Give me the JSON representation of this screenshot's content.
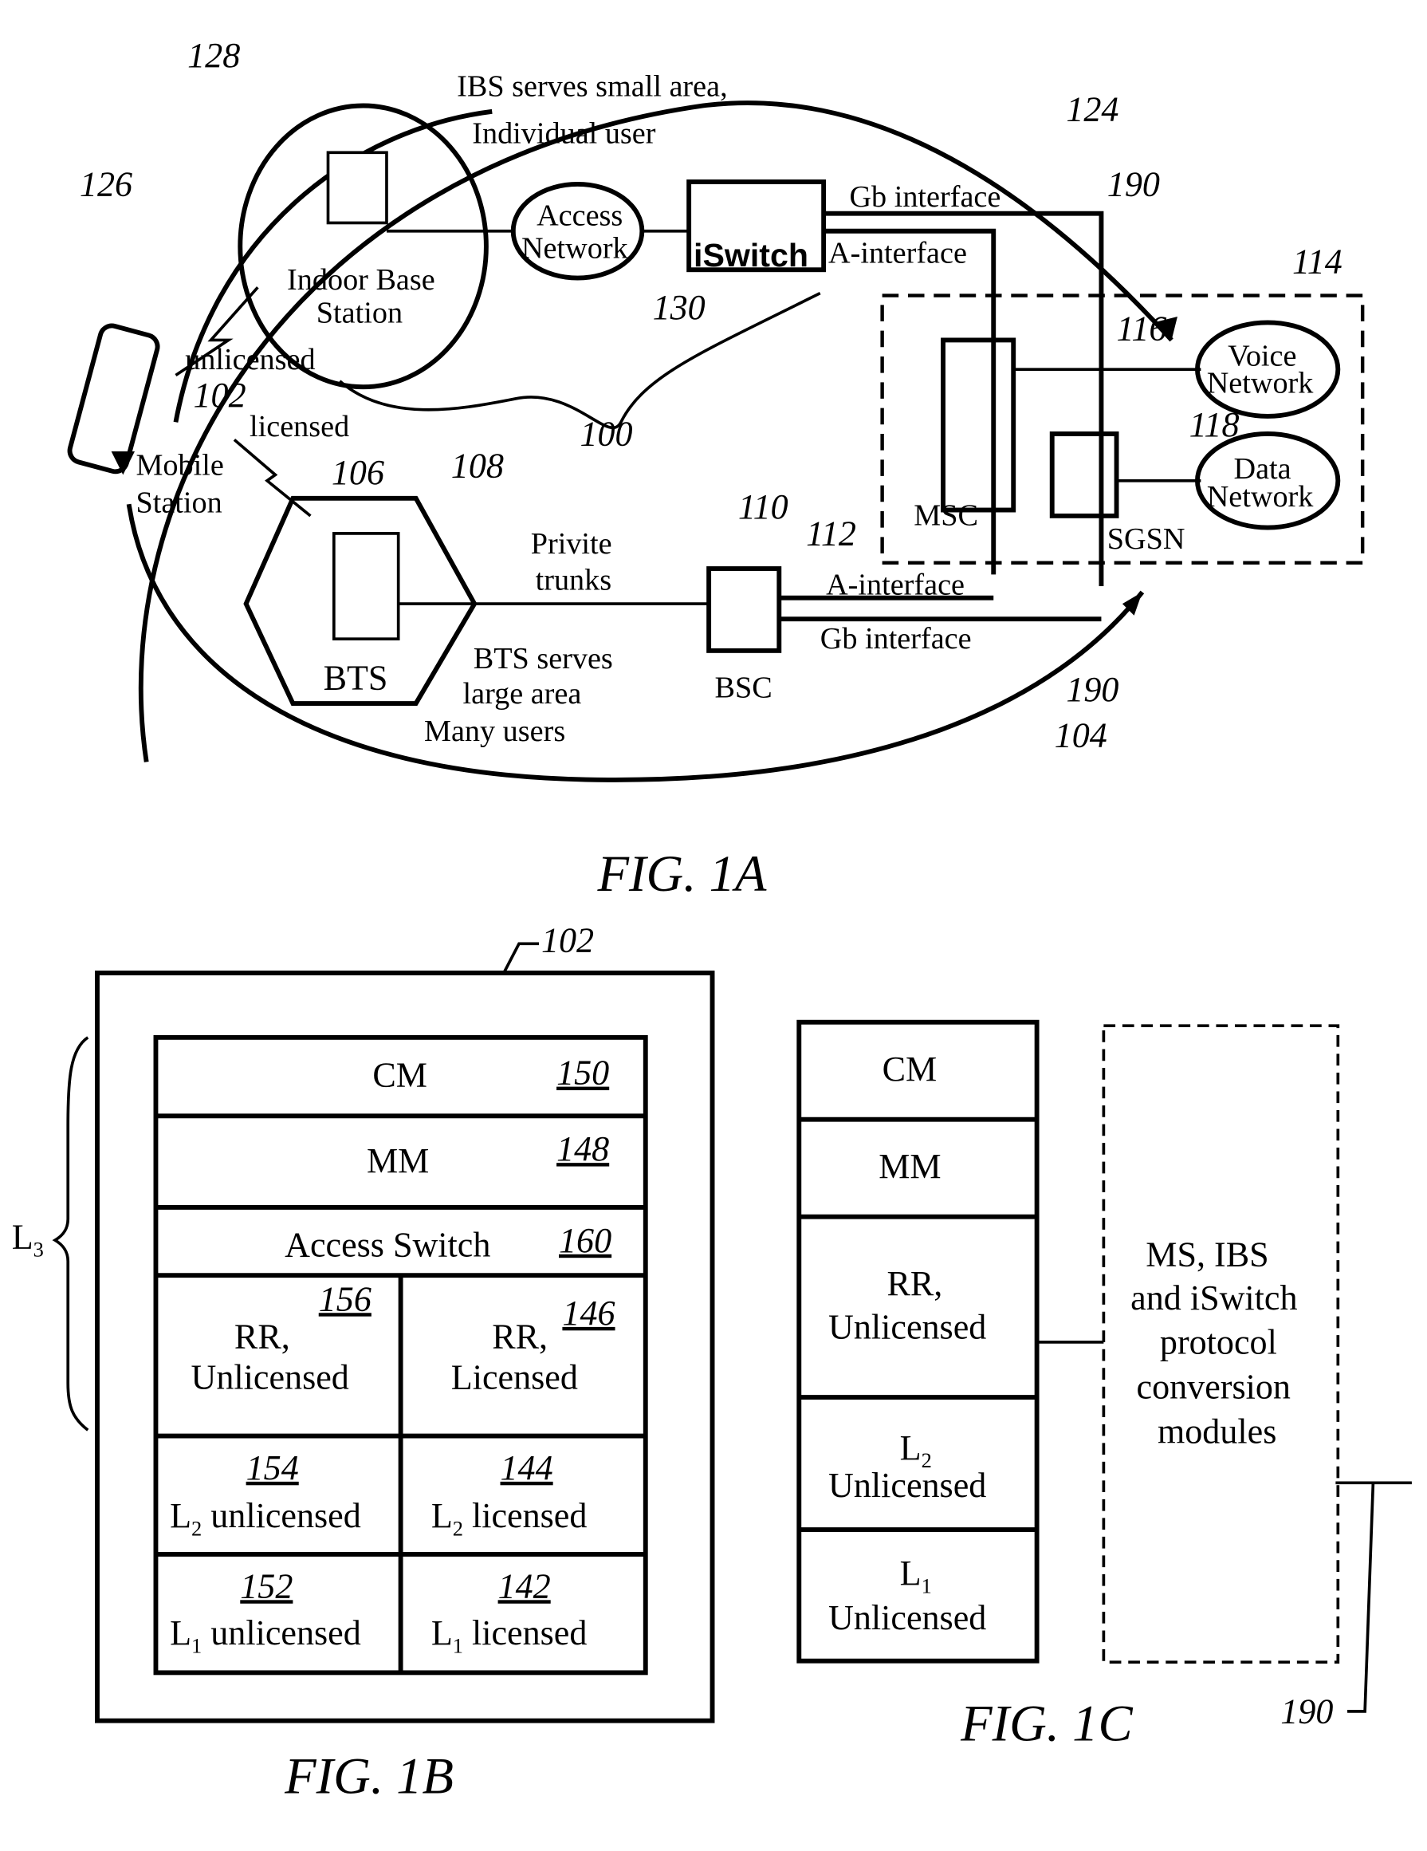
{
  "fig1a": {
    "title": "FIG. 1A",
    "refs": {
      "r128": "128",
      "r126": "126",
      "r124": "124",
      "r190a": "190",
      "r114": "114",
      "r116": "116",
      "r118": "118",
      "r130": "130",
      "r100": "100",
      "r102": "102",
      "r106": "106",
      "r108": "108",
      "r110": "110",
      "r112": "112",
      "r190b": "190",
      "r104": "104"
    },
    "labels": {
      "ibs1": "IBS serves small area,",
      "ibs2": "Individual user",
      "indoor1": "Indoor Base",
      "indoor2": "Station",
      "access1": "Access",
      "access2": "Network",
      "iswitch": "iSwitch",
      "gb_top": "Gb interface",
      "a_top": "A-interface",
      "unlicensed": "unlicensed",
      "licensed": "licensed",
      "mobile1": "Mobile",
      "mobile2": "Station",
      "voice1": "Voice",
      "voice2": "Network",
      "data1": "Data",
      "data2": "Network",
      "msc": "MSC",
      "sgsn": "SGSN",
      "priv1": "Privite",
      "priv2": "trunks",
      "bts": "BTS",
      "bts1": "BTS serves",
      "bts2": "large area",
      "bts3": "Many users",
      "bsc": "BSC",
      "a_bot": "A-interface",
      "gb_bot": "Gb interface"
    }
  },
  "fig1b": {
    "title": "FIG. 1B",
    "ref": "102",
    "brace": "L",
    "brace_sub": "3",
    "rows": [
      {
        "label": "CM",
        "ref": "150"
      },
      {
        "label": "MM",
        "ref": "148"
      },
      {
        "label": "Access Switch",
        "ref": "160"
      }
    ],
    "cells": [
      {
        "l1": "RR,",
        "l2": "Unlicensed",
        "ref": "156"
      },
      {
        "l1": "RR,",
        "l2": "Licensed",
        "ref": "146"
      },
      {
        "l1": "L",
        "sub": "2",
        "l2": " unlicensed",
        "ref": "154"
      },
      {
        "l1": "L",
        "sub": "2",
        "l2": " licensed",
        "ref": "144"
      },
      {
        "l1": "L",
        "sub": "1",
        "l2": " unlicensed",
        "ref": "152"
      },
      {
        "l1": "L",
        "sub": "1",
        "l2": " licensed",
        "ref": "142"
      }
    ]
  },
  "fig1c": {
    "title": "FIG. 1C",
    "ref": "190",
    "stack": [
      "CM",
      "MM",
      "RR,",
      "Unlicensed",
      "L",
      "2",
      "Unlicensed",
      "L",
      "1",
      "Unlicensed"
    ],
    "module": [
      "MS, IBS",
      "and iSwitch",
      "protocol",
      "conversion",
      "modules"
    ]
  }
}
